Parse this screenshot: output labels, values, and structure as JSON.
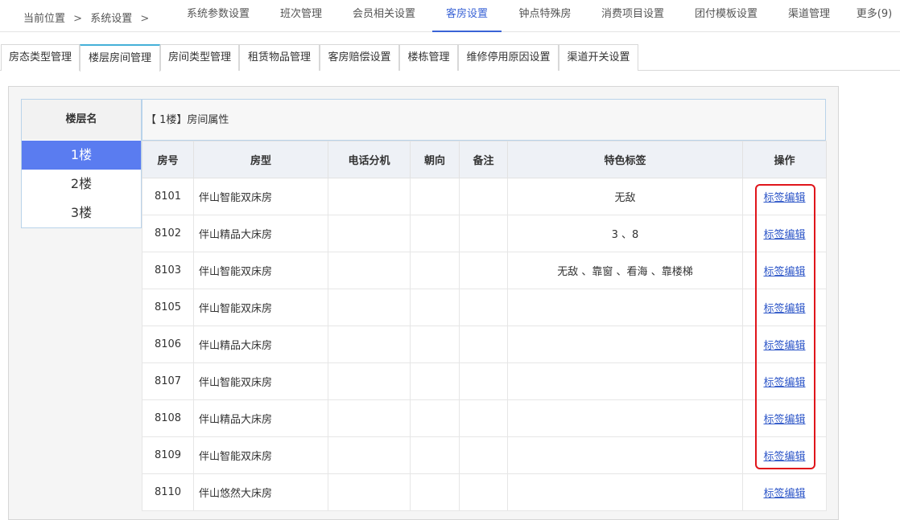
{
  "breadcrumb": {
    "prefix": "当前位置",
    "sep": ">",
    "item1": "系统设置",
    "sep2": ">"
  },
  "nav": {
    "items": [
      {
        "label": "系统参数设置"
      },
      {
        "label": "班次管理"
      },
      {
        "label": "会员相关设置"
      },
      {
        "label": "客房设置"
      },
      {
        "label": "钟点特殊房"
      },
      {
        "label": "消费项目设置"
      },
      {
        "label": "团付模板设置"
      },
      {
        "label": "渠道管理"
      },
      {
        "label": "更多(9)"
      }
    ],
    "active_index": 3
  },
  "subtabs": {
    "items": [
      {
        "label": "房态类型管理"
      },
      {
        "label": "楼层房间管理"
      },
      {
        "label": "房间类型管理"
      },
      {
        "label": "租赁物品管理"
      },
      {
        "label": "客房赔偿设置"
      },
      {
        "label": "楼栋管理"
      },
      {
        "label": "维修停用原因设置"
      },
      {
        "label": "渠道开关设置"
      }
    ],
    "active_index": 1
  },
  "floors": {
    "header": "楼层名",
    "items": [
      {
        "label": "1楼"
      },
      {
        "label": "2楼"
      },
      {
        "label": "3楼"
      }
    ],
    "active_index": 0
  },
  "rooms": {
    "title": "【 1楼】房间属性",
    "columns": {
      "no": "房号",
      "type": "房型",
      "phone": "电话分机",
      "orientation": "朝向",
      "remark": "备注",
      "tags": "特色标签",
      "action": "操作"
    },
    "action_label": "标签编辑",
    "rows": [
      {
        "no": "8101",
        "type": "伴山智能双床房",
        "phone": "",
        "orientation": "",
        "remark": "",
        "tags": "无敌"
      },
      {
        "no": "8102",
        "type": "伴山精品大床房",
        "phone": "",
        "orientation": "",
        "remark": "",
        "tags": "3 、8"
      },
      {
        "no": "8103",
        "type": "伴山智能双床房",
        "phone": "",
        "orientation": "",
        "remark": "",
        "tags": "无敌 、靠窗 、看海 、靠楼梯"
      },
      {
        "no": "8105",
        "type": "伴山智能双床房",
        "phone": "",
        "orientation": "",
        "remark": "",
        "tags": ""
      },
      {
        "no": "8106",
        "type": "伴山精品大床房",
        "phone": "",
        "orientation": "",
        "remark": "",
        "tags": ""
      },
      {
        "no": "8107",
        "type": "伴山智能双床房",
        "phone": "",
        "orientation": "",
        "remark": "",
        "tags": ""
      },
      {
        "no": "8108",
        "type": "伴山精品大床房",
        "phone": "",
        "orientation": "",
        "remark": "",
        "tags": ""
      },
      {
        "no": "8109",
        "type": "伴山智能双床房",
        "phone": "",
        "orientation": "",
        "remark": "",
        "tags": ""
      },
      {
        "no": "8110",
        "type": "伴山悠然大床房",
        "phone": "",
        "orientation": "",
        "remark": "",
        "tags": ""
      }
    ]
  },
  "colors": {
    "accent": "#3a63d6",
    "floor_active": "#5a7cf0",
    "link": "#2d56c8",
    "highlight": "#e0151b"
  }
}
